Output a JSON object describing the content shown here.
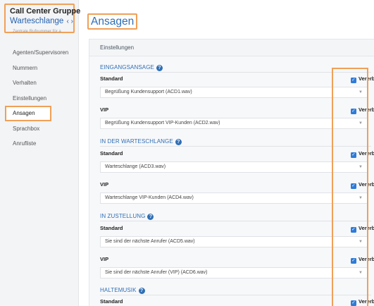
{
  "sidebar": {
    "title": "Call Center Gruppe",
    "subtitle": "Warteschlange",
    "arrows": "‹ ›",
    "hint": "Zentrale Rufnummer für a",
    "items": [
      {
        "label": "Agenten/Supervisoren"
      },
      {
        "label": "Nummern"
      },
      {
        "label": "Verhalten"
      },
      {
        "label": "Einstellungen"
      },
      {
        "label": "Ansagen"
      },
      {
        "label": "Sprachbox"
      },
      {
        "label": "Anrufliste"
      }
    ]
  },
  "page": {
    "title": "Ansagen",
    "panel_title": "Einstellungen"
  },
  "inherit_label": "Vererbt",
  "sections": [
    {
      "title": "EINGANGSANSAGE",
      "rows": [
        {
          "label": "Standard",
          "value": "Begrüßung Kundensupport (ACD1.wav)",
          "inherit": true
        },
        {
          "label": "VIP",
          "value": "Begrüßung Kundensupport VIP-Kunden (ACD2.wav)",
          "inherit": true
        }
      ]
    },
    {
      "title": "IN DER WARTESCHLANGE",
      "rows": [
        {
          "label": "Standard",
          "value": "Warteschlange (ACD3.wav)",
          "inherit": true
        },
        {
          "label": "VIP",
          "value": "Warteschlange VIP-Kunden (ACD4.wav)",
          "inherit": true
        }
      ]
    },
    {
      "title": "IN ZUSTELLUNG",
      "rows": [
        {
          "label": "Standard",
          "value": "Sie sind der nächste Anrufer (ACD5.wav)",
          "inherit": true
        },
        {
          "label": "VIP",
          "value": "Sie sind der nächste Anrufer (VIP) (ACD6.wav)",
          "inherit": true
        }
      ]
    },
    {
      "title": "HALTEMUSIK",
      "rows": [
        {
          "label": "Standard",
          "inherit": true
        }
      ]
    }
  ],
  "colors": {
    "accent": "#2f6fb5",
    "highlight_border": "#f0a058",
    "checkbox": "#2f7bd6"
  },
  "icons": {
    "help": "question-circle-icon",
    "select_chevron": "chevron-down-icon",
    "checkbox": "checkbox-checked-icon",
    "nav_arrows": "prev-next-arrows-icon"
  }
}
